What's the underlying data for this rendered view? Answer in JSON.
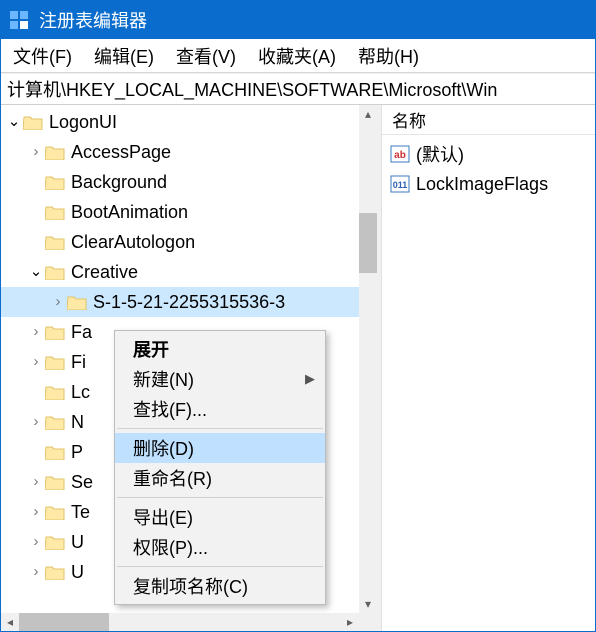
{
  "title": "注册表编辑器",
  "menu": {
    "file": "文件(F)",
    "edit": "编辑(E)",
    "view": "查看(V)",
    "favorites": "收藏夹(A)",
    "help": "帮助(H)"
  },
  "address": "计算机\\HKEY_LOCAL_MACHINE\\SOFTWARE\\Microsoft\\Win",
  "tree": [
    {
      "indent": 0,
      "arrow": "open",
      "label": "LogonUI"
    },
    {
      "indent": 1,
      "arrow": "close",
      "label": "AccessPage"
    },
    {
      "indent": 1,
      "arrow": "none",
      "label": "Background"
    },
    {
      "indent": 1,
      "arrow": "none",
      "label": "BootAnimation"
    },
    {
      "indent": 1,
      "arrow": "none",
      "label": "ClearAutologon"
    },
    {
      "indent": 1,
      "arrow": "open",
      "label": "Creative"
    },
    {
      "indent": 2,
      "arrow": "close",
      "label": "S-1-5-21-2255315536-3",
      "selected": true
    },
    {
      "indent": 1,
      "arrow": "close",
      "label": "Fa"
    },
    {
      "indent": 1,
      "arrow": "close",
      "label": "Fi"
    },
    {
      "indent": 1,
      "arrow": "none",
      "label": "Lc"
    },
    {
      "indent": 1,
      "arrow": "close",
      "label": "N"
    },
    {
      "indent": 1,
      "arrow": "none",
      "label": "P"
    },
    {
      "indent": 1,
      "arrow": "close",
      "label": "Se"
    },
    {
      "indent": 1,
      "arrow": "close",
      "label": "Te"
    },
    {
      "indent": 1,
      "arrow": "close",
      "label": "U"
    },
    {
      "indent": 1,
      "arrow": "close",
      "label": "U"
    }
  ],
  "list_header": {
    "name": "名称"
  },
  "values": [
    {
      "type": "string",
      "name": "(默认)"
    },
    {
      "type": "binary",
      "name": "LockImageFlags"
    }
  ],
  "context_menu": {
    "expand": "展开",
    "new": "新建(N)",
    "find": "查找(F)...",
    "delete": "删除(D)",
    "rename": "重命名(R)",
    "export": "导出(E)",
    "permissions": "权限(P)...",
    "copy_key_name": "复制项名称(C)"
  }
}
